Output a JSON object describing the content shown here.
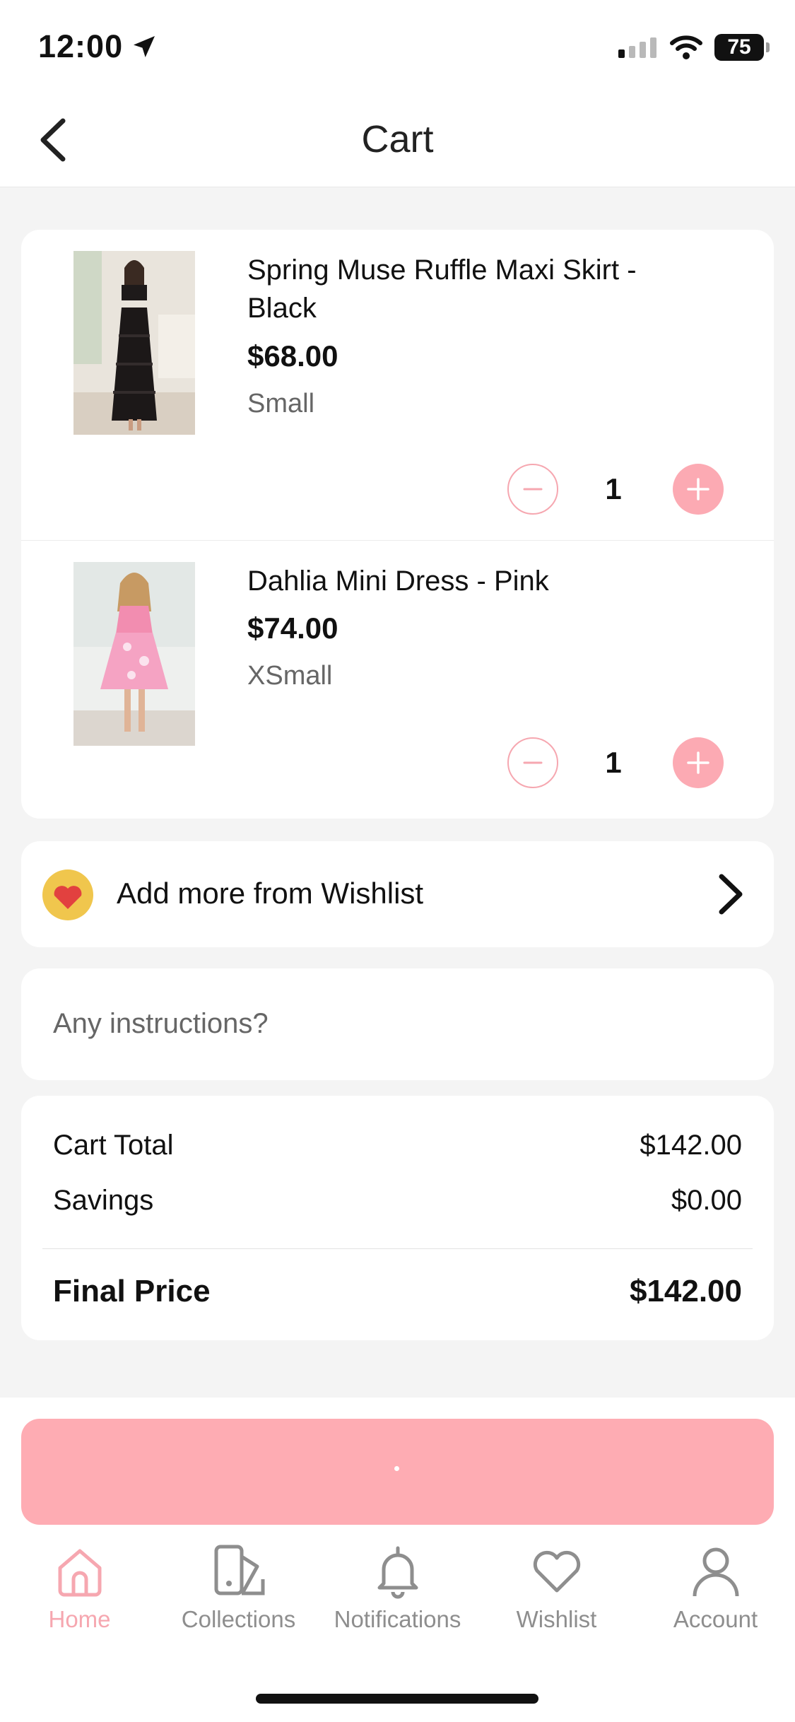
{
  "status_bar": {
    "time": "12:00",
    "battery": "75"
  },
  "header": {
    "title": "Cart"
  },
  "cart": {
    "items": [
      {
        "name": "Spring Muse Ruffle Maxi Skirt - Black",
        "price": "$68.00",
        "size": "Small",
        "quantity": "1"
      },
      {
        "name": "Dahlia Mini Dress - Pink",
        "price": "$74.00",
        "size": "XSmall",
        "quantity": "1"
      }
    ]
  },
  "wishlist_prompt": {
    "label": "Add more from Wishlist"
  },
  "instructions": {
    "placeholder": "Any instructions?"
  },
  "summary": {
    "cart_total_label": "Cart Total",
    "cart_total_value": "$142.00",
    "savings_label": "Savings",
    "savings_value": "$0.00",
    "final_label": "Final Price",
    "final_value": "$142.00"
  },
  "tabbar": {
    "items": [
      {
        "label": "Home",
        "icon": "home-icon",
        "active": true
      },
      {
        "label": "Collections",
        "icon": "collections-icon",
        "active": false
      },
      {
        "label": "Notifications",
        "icon": "bell-icon",
        "active": false
      },
      {
        "label": "Wishlist",
        "icon": "heart-icon",
        "active": false
      },
      {
        "label": "Account",
        "icon": "account-icon",
        "active": false
      }
    ]
  },
  "colors": {
    "accent": "#feacb3",
    "active_tab": "#f6a7b0",
    "background": "#f4f4f4"
  }
}
